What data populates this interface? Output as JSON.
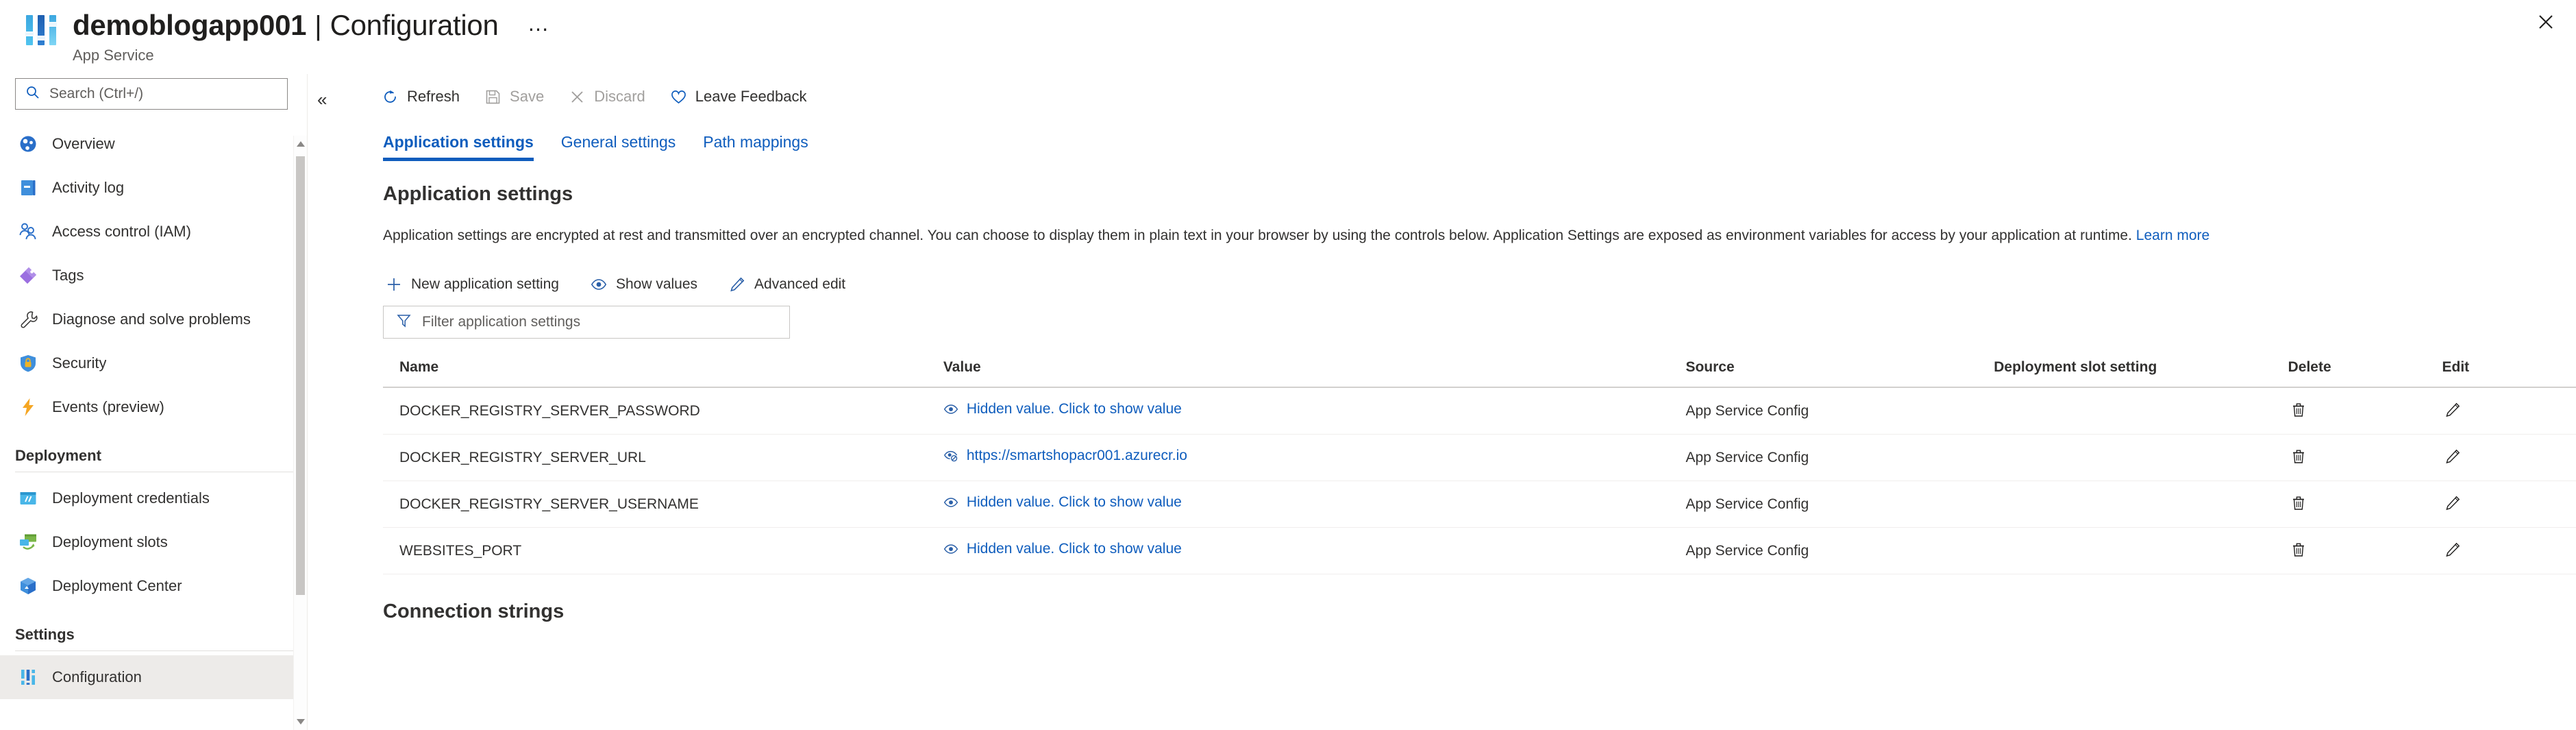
{
  "header": {
    "resource_name": "demoblogapp001",
    "separator": "|",
    "page_name": "Configuration",
    "subtitle": "App Service",
    "more_label": "…",
    "close_label": "close-icon",
    "icon": "configuration-sliders-icon"
  },
  "search": {
    "placeholder": "Search (Ctrl+/)",
    "value": ""
  },
  "sidebar": {
    "items": [
      {
        "label": "Overview",
        "icon": "overview-globe-icon",
        "type": "item",
        "selected": false
      },
      {
        "label": "Activity log",
        "icon": "activity-log-book-icon",
        "type": "item",
        "selected": false
      },
      {
        "label": "Access control (IAM)",
        "icon": "access-control-people-icon",
        "type": "item",
        "selected": false
      },
      {
        "label": "Tags",
        "icon": "tags-icon",
        "type": "item",
        "selected": false
      },
      {
        "label": "Diagnose and solve problems",
        "icon": "wrench-icon",
        "type": "item",
        "selected": false
      },
      {
        "label": "Security",
        "icon": "shield-lock-icon",
        "type": "item",
        "selected": false
      },
      {
        "label": "Events (preview)",
        "icon": "lightning-bolt-icon",
        "type": "item",
        "selected": false
      },
      {
        "label": "Deployment",
        "type": "group"
      },
      {
        "label": "Deployment credentials",
        "icon": "deployment-credentials-icon",
        "type": "item",
        "selected": false
      },
      {
        "label": "Deployment slots",
        "icon": "deployment-slots-icon",
        "type": "item",
        "selected": false
      },
      {
        "label": "Deployment Center",
        "icon": "deployment-center-box-icon",
        "type": "item",
        "selected": false
      },
      {
        "label": "Settings",
        "type": "group"
      },
      {
        "label": "Configuration",
        "icon": "configuration-sliders-icon",
        "type": "item",
        "selected": true
      }
    ]
  },
  "toolbar": {
    "collapse_label": "«",
    "buttons": [
      {
        "label": "Refresh",
        "icon": "refresh-icon",
        "disabled": false
      },
      {
        "label": "Save",
        "icon": "save-floppy-icon",
        "disabled": true
      },
      {
        "label": "Discard",
        "icon": "discard-x-icon",
        "disabled": true
      },
      {
        "label": "Leave Feedback",
        "icon": "heart-icon",
        "disabled": false
      }
    ]
  },
  "tabs": [
    {
      "label": "Application settings",
      "active": true
    },
    {
      "label": "General settings",
      "active": false
    },
    {
      "label": "Path mappings",
      "active": false
    }
  ],
  "section": {
    "title": "Application settings",
    "description": "Application settings are encrypted at rest and transmitted over an encrypted channel. You can choose to display them in plain text in your browser by using the controls below. Application Settings are exposed as environment variables for access by your application at runtime.",
    "learn_more": "Learn more"
  },
  "commands": [
    {
      "label": "New application setting",
      "icon": "plus-icon"
    },
    {
      "label": "Show values",
      "icon": "eye-icon"
    },
    {
      "label": "Advanced edit",
      "icon": "pencil-icon"
    }
  ],
  "filter": {
    "placeholder": "Filter application settings",
    "value": "",
    "icon": "funnel-icon"
  },
  "table": {
    "columns": [
      "Name",
      "Value",
      "Source",
      "Deployment slot setting",
      "Delete",
      "Edit"
    ],
    "rows": [
      {
        "name": "DOCKER_REGISTRY_SERVER_PASSWORD",
        "value": "Hidden value. Click to show value",
        "value_icon": "eye-icon",
        "value_hidden": true,
        "source": "App Service Config",
        "slot": "",
        "delete_icon": "trash-icon",
        "edit_icon": "pencil-icon"
      },
      {
        "name": "DOCKER_REGISTRY_SERVER_URL",
        "value": "https://smartshopacr001.azurecr.io",
        "value_icon": "eye-off-icon",
        "value_hidden": false,
        "source": "App Service Config",
        "slot": "",
        "delete_icon": "trash-icon",
        "edit_icon": "pencil-icon"
      },
      {
        "name": "DOCKER_REGISTRY_SERVER_USERNAME",
        "value": "Hidden value. Click to show value",
        "value_icon": "eye-icon",
        "value_hidden": true,
        "source": "App Service Config",
        "slot": "",
        "delete_icon": "trash-icon",
        "edit_icon": "pencil-icon"
      },
      {
        "name": "WEBSITES_PORT",
        "value": "Hidden value. Click to show value",
        "value_icon": "eye-icon",
        "value_hidden": true,
        "source": "App Service Config",
        "slot": "",
        "delete_icon": "trash-icon",
        "edit_icon": "pencil-icon"
      }
    ]
  },
  "connection_strings": {
    "title": "Connection strings"
  },
  "colors": {
    "link": "#0f5dbd",
    "text": "#323130",
    "muted": "#605e5c",
    "selected_bg": "#edebe9",
    "border": "#c8c6c4"
  }
}
